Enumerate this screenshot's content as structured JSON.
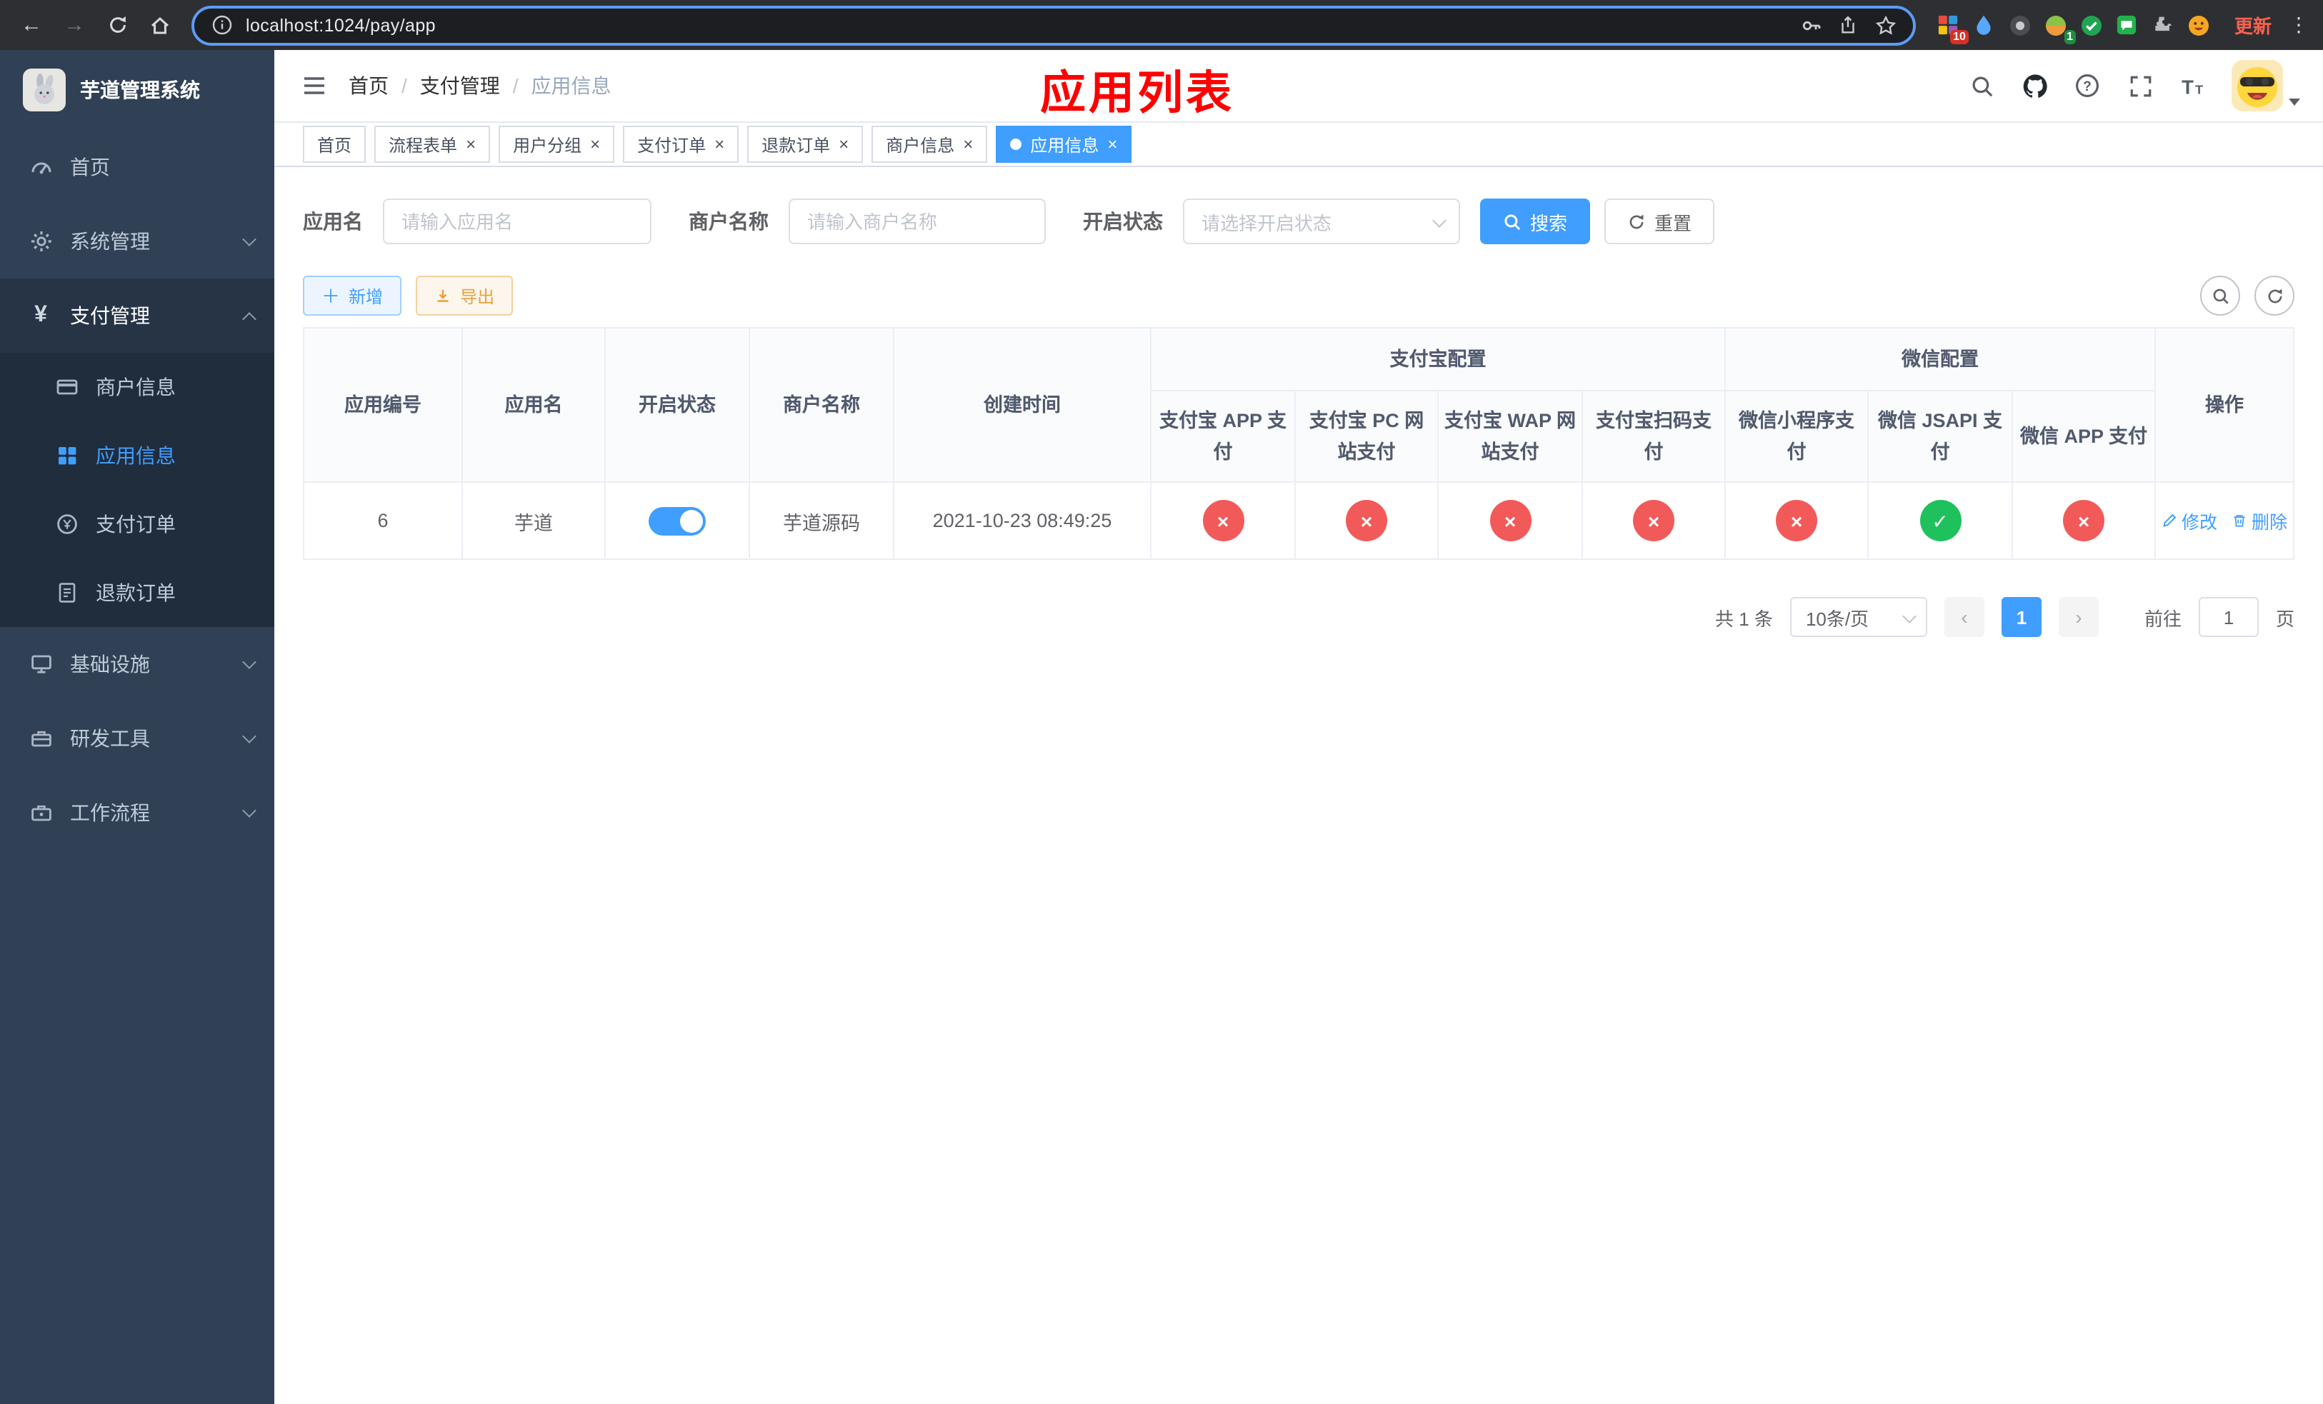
{
  "colors": {
    "primary": "#409eff",
    "danger": "#f25a5a",
    "success": "#1ec15b",
    "warning": "#e6a23c",
    "title_red": "#ff0000"
  },
  "browser": {
    "url": "localhost:1024/pay/app",
    "update_label": "更新",
    "grid_ext_badge": "10",
    "avatar_ext_badge": "1"
  },
  "sidebar": {
    "app_title": "芋道管理系统",
    "home": "首页",
    "system": "系统管理",
    "payment": "支付管理",
    "payment_children": {
      "merchant": "商户信息",
      "app": "应用信息",
      "order": "支付订单",
      "refund": "退款订单"
    },
    "infra": "基础设施",
    "devtools": "研发工具",
    "workflow": "工作流程"
  },
  "navbar": {
    "breadcrumb": [
      "首页",
      "支付管理",
      "应用信息"
    ]
  },
  "page_title": "应用列表",
  "tabs": [
    {
      "label": "首页"
    },
    {
      "label": "流程表单"
    },
    {
      "label": "用户分组"
    },
    {
      "label": "支付订单"
    },
    {
      "label": "退款订单"
    },
    {
      "label": "商户信息"
    },
    {
      "label": "应用信息"
    }
  ],
  "filters": {
    "app_name_label": "应用名",
    "app_name_placeholder": "请输入应用名",
    "merchant_label": "商户名称",
    "merchant_placeholder": "请输入商户名称",
    "status_label": "开启状态",
    "status_placeholder": "请选择开启状态",
    "search_label": "搜索",
    "reset_label": "重置"
  },
  "toolbar": {
    "add_label": "新增",
    "export_label": "导出"
  },
  "table": {
    "col_app_id": "应用编号",
    "col_app_name": "应用名",
    "col_status": "开启状态",
    "col_merchant": "商户名称",
    "col_created": "创建时间",
    "col_op": "操作",
    "group_alipay": "支付宝配置",
    "group_wechat": "微信配置",
    "alipay_cols": [
      "支付宝 APP 支付",
      "支付宝 PC 网站支付",
      "支付宝 WAP 网站支付",
      "支付宝扫码支付"
    ],
    "wechat_cols": [
      "微信小程序支付",
      "微信 JSAPI 支付",
      "微信 APP 支付"
    ],
    "rows": [
      {
        "app_id": "6",
        "app_name": "芋道",
        "enabled": true,
        "merchant": "芋道源码",
        "created": "2021-10-23 08:49:25",
        "pay_statuses": [
          "no",
          "no",
          "no",
          "no",
          "no",
          "yes",
          "no"
        ],
        "edit_label": "修改",
        "delete_label": "删除"
      }
    ]
  },
  "pagination": {
    "total": "共 1 条",
    "page_size": "10条/页",
    "page": "1",
    "goto": "前往",
    "goto_value": "1",
    "unit": "页"
  }
}
